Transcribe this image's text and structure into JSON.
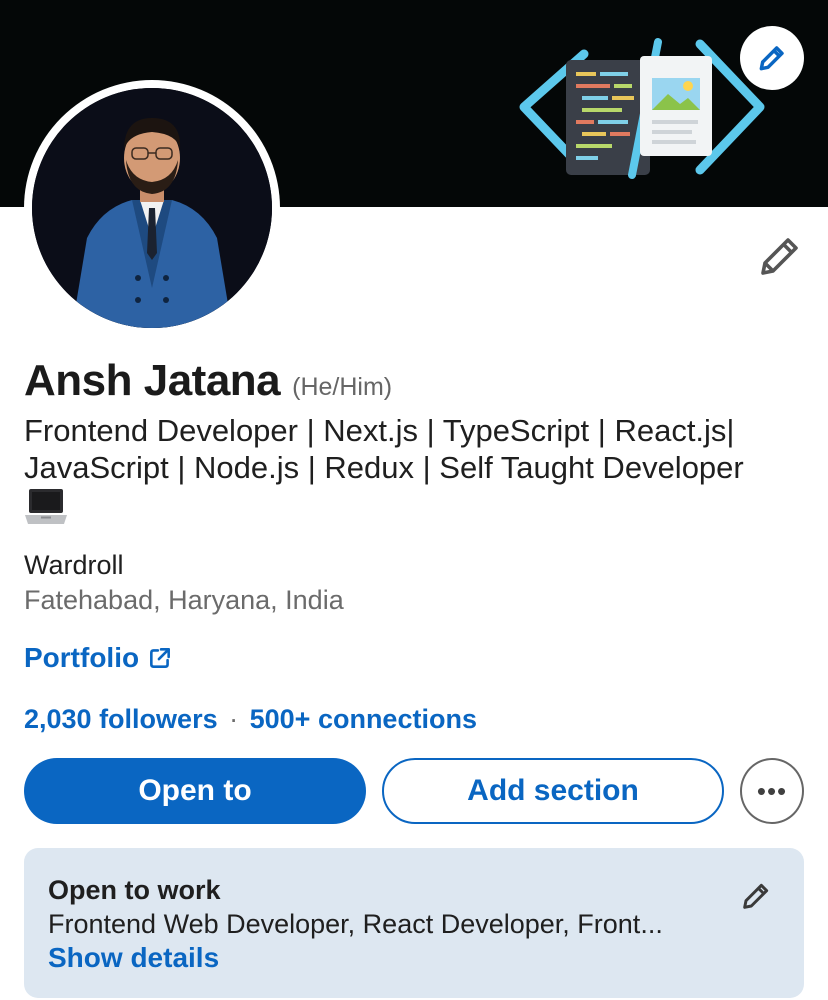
{
  "profile": {
    "name": "Ansh Jatana",
    "pronouns": "(He/Him)",
    "headline": "Frontend Developer | Next.js | TypeScript | React.js| JavaScript | Node.js | Redux | Self Taught Developer",
    "company": "Wardroll",
    "location": "Fatehabad, Haryana, India",
    "website_label": "Portfolio",
    "followers": "2,030 followers",
    "separator": "·",
    "connections": "500+ connections"
  },
  "actions": {
    "open_to": "Open to",
    "add_section": "Add section",
    "more": "•••"
  },
  "open_to_work": {
    "title": "Open to work",
    "roles": "Frontend Web Developer, React Developer, Front...",
    "show_details": "Show details"
  },
  "icons": {
    "banner_edit": "pencil-icon",
    "profile_edit": "pencil-icon",
    "headline_emoji": "laptop-icon",
    "external_link": "external-link-icon",
    "more": "ellipsis-icon",
    "card_edit": "pencil-icon"
  },
  "colors": {
    "brand_blue": "#0a66c2",
    "banner_bg": "#040707",
    "card_bg": "#dde7f1",
    "muted_text": "#6b6b6b"
  }
}
